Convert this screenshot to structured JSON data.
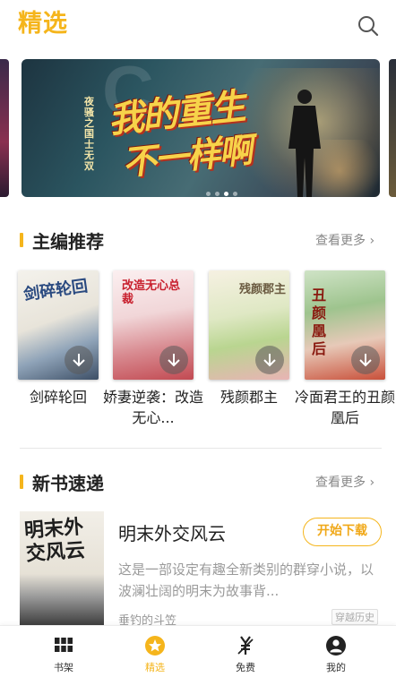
{
  "header": {
    "title": "精选",
    "search_icon": "search-icon"
  },
  "carousel": {
    "banner": {
      "title_line1": "我的重生",
      "title_line2": "不一样啊",
      "author": "夜骚之国士无双",
      "watermark": "C"
    },
    "page_count": 4,
    "active_page": 3
  },
  "editor_picks": {
    "title": "主编推荐",
    "more_label": "查看更多 ›",
    "books": [
      {
        "title": "剑碎轮回",
        "cover_text": "剑碎轮回"
      },
      {
        "title": "娇妻逆袭：改造无心...",
        "cover_text": "改造无心总裁"
      },
      {
        "title": "残颜郡主",
        "cover_text": "残颜郡主"
      },
      {
        "title": "冷面君王的丑颜凰后",
        "cover_text": "丑颜凰后"
      }
    ]
  },
  "new_books": {
    "title": "新书速递",
    "more_label": "查看更多 ›",
    "book": {
      "title": "明末外交风云",
      "download_label": "开始下载",
      "description": "这是一部设定有趣全新类别的群穿小说，以波澜壮阔的明末为故事背...",
      "author": "垂钓的斗笠",
      "tag": "穿越历史",
      "cover_text": "明末外交风云"
    }
  },
  "bottom_nav": {
    "items": [
      {
        "label": "书架",
        "icon": "grid-icon",
        "active": false
      },
      {
        "label": "精选",
        "icon": "star-circle-icon",
        "active": true
      },
      {
        "label": "免费",
        "icon": "free-ticket-icon",
        "active": false
      },
      {
        "label": "我的",
        "icon": "user-icon",
        "active": false
      }
    ]
  },
  "colors": {
    "accent": "#f5b51c",
    "text_primary": "#222222",
    "text_secondary": "#9a9a9a"
  }
}
